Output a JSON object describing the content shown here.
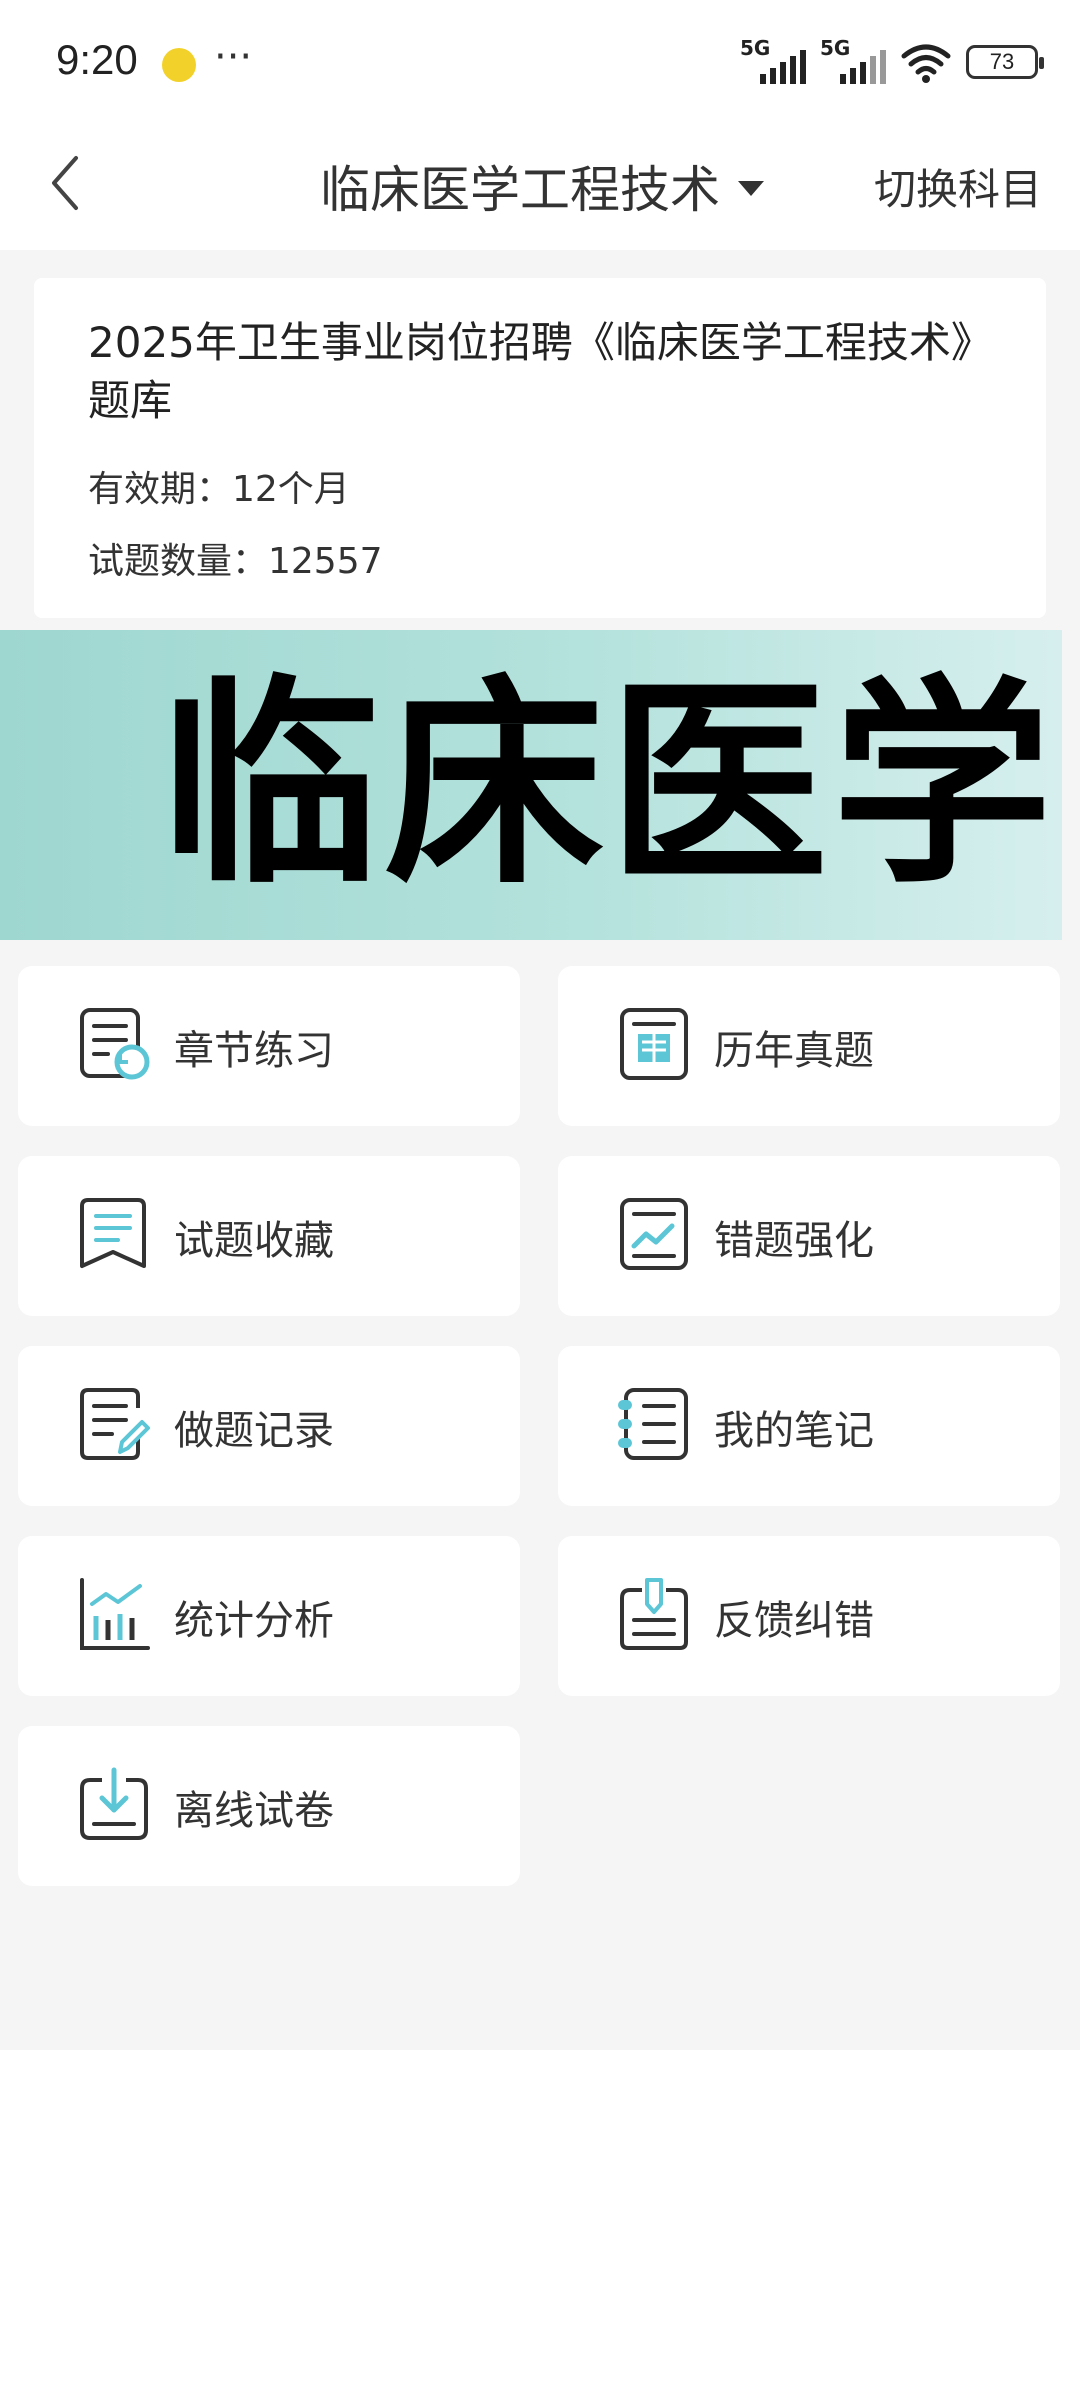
{
  "status_bar": {
    "time": "9:20",
    "more": "···",
    "signal1_label": "5G",
    "signal2_label": "5G",
    "battery": "73"
  },
  "nav": {
    "title": "临床医学工程技术",
    "switch_label": "切换科目"
  },
  "info_card": {
    "title": "2025年卫生事业岗位招聘《临床医学工程技术》题库",
    "validity": "有效期：12个月",
    "question_count": "试题数量：12557"
  },
  "banner": {
    "text": "临床医学"
  },
  "menu": {
    "items": [
      {
        "label": "章节练习",
        "icon": "chapter-practice-icon"
      },
      {
        "label": "历年真题",
        "icon": "past-exams-icon"
      },
      {
        "label": "试题收藏",
        "icon": "bookmark-icon"
      },
      {
        "label": "错题强化",
        "icon": "mistake-chart-icon"
      },
      {
        "label": "做题记录",
        "icon": "record-edit-icon"
      },
      {
        "label": "我的笔记",
        "icon": "notebook-icon"
      },
      {
        "label": "统计分析",
        "icon": "statistics-icon"
      },
      {
        "label": "反馈纠错",
        "icon": "feedback-icon"
      },
      {
        "label": "离线试卷",
        "icon": "download-icon"
      }
    ]
  },
  "colors": {
    "accent": "#5cc6d6",
    "icon_stroke": "#333333",
    "page_bg": "#f5f5f5",
    "banner_start": "#9ed7d0",
    "banner_end": "#d6efee"
  }
}
